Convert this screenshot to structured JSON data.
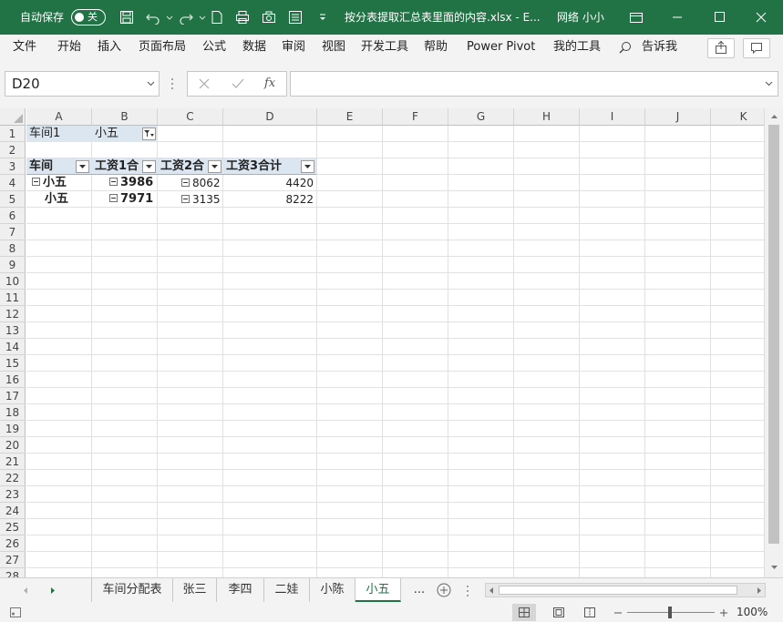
{
  "titlebar": {
    "autosave_label": "自动保存",
    "autosave_state": "关",
    "filename": "按分表提取汇总表里面的内容.xlsx  -  E...",
    "user": "网络 小小"
  },
  "ribbon": {
    "tabs": [
      "文件",
      "开始",
      "插入",
      "页面布局",
      "公式",
      "数据",
      "审阅",
      "视图",
      "开发工具",
      "帮助",
      "Power Pivot",
      "我的工具"
    ],
    "tell_me": "告诉我"
  },
  "formula_bar": {
    "name_box": "D20",
    "fx": "fx",
    "formula": ""
  },
  "grid": {
    "columns": [
      "A",
      "B",
      "C",
      "D",
      "E",
      "F",
      "G",
      "H",
      "I",
      "J",
      "K"
    ],
    "rows": [
      "1",
      "2",
      "3",
      "4",
      "5",
      "6",
      "7",
      "8",
      "9",
      "10",
      "11",
      "12",
      "13",
      "14",
      "15",
      "16",
      "17",
      "18",
      "19",
      "20",
      "21",
      "22",
      "23",
      "24",
      "25",
      "26",
      "27",
      "28"
    ],
    "cells": {
      "A1": "车间1",
      "B1": "小五",
      "A3": "车间",
      "B3": "工资1合",
      "C3": "工资2合",
      "D3": "工资3合计",
      "A4": "小五",
      "B4": "3986",
      "C4": "8062",
      "D4": "4420",
      "A5": "小五",
      "B5": "7971",
      "C5": "3135",
      "D5": "8222"
    }
  },
  "sheets": {
    "tabs": [
      "车间分配表",
      "张三",
      "李四",
      "二娃",
      "小陈",
      "小五"
    ],
    "active": "小五",
    "more": "..."
  },
  "status": {
    "zoom": "100%"
  },
  "colors": {
    "excel_green": "#217346",
    "pivot_header": "#dce6f1"
  }
}
